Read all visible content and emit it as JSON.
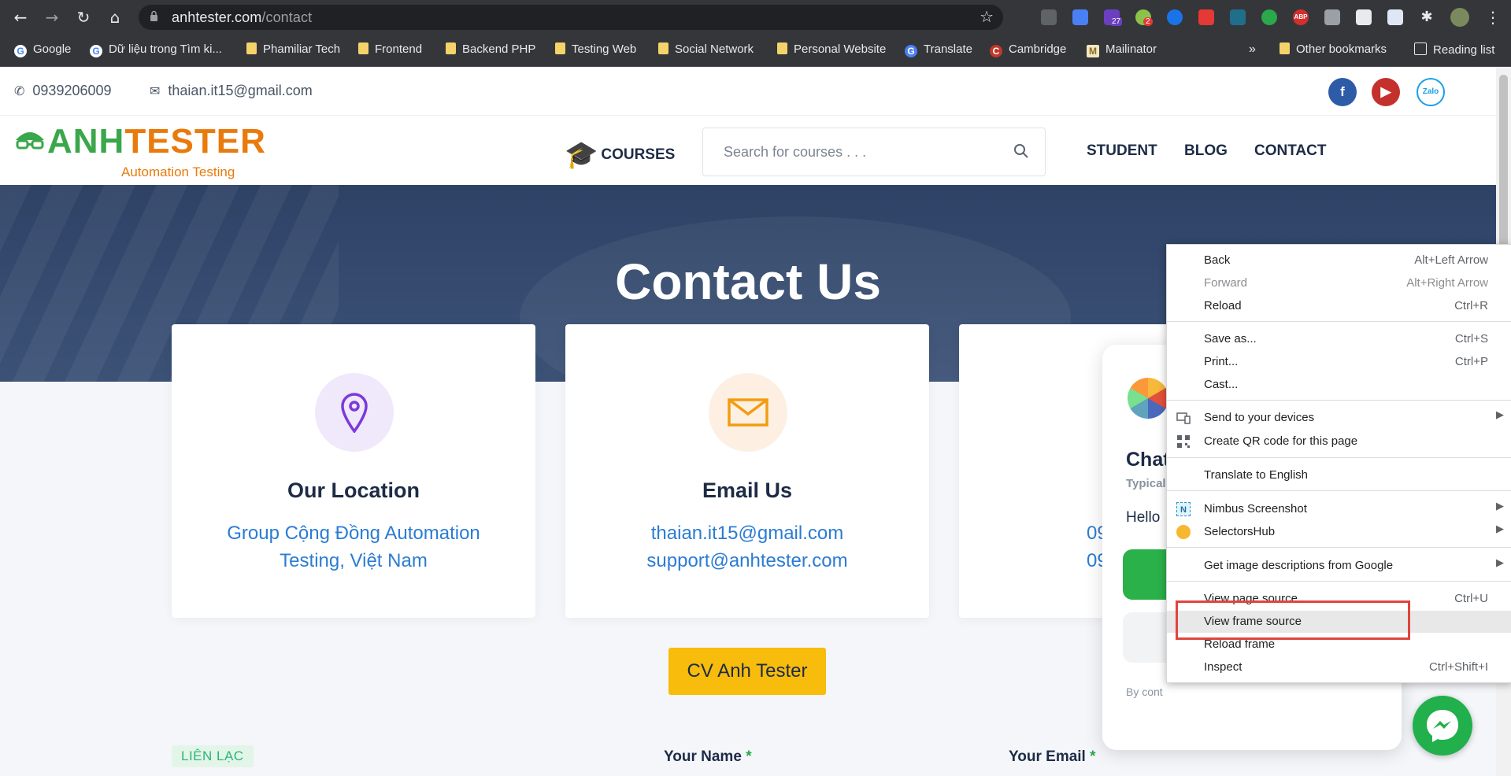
{
  "browser": {
    "url_host": "anhtester.com",
    "url_path": "/contact",
    "ext_badges": {
      "purple": "27",
      "red": "2"
    },
    "ext_abp": "ABP",
    "bookmarks": [
      {
        "label": "Google",
        "type": "google"
      },
      {
        "label": "Dữ liệu trong Tìm ki...",
        "type": "google"
      },
      {
        "label": "Phamiliar Tech",
        "type": "folder"
      },
      {
        "label": "Frontend",
        "type": "folder"
      },
      {
        "label": "Backend PHP",
        "type": "folder"
      },
      {
        "label": "Testing Web",
        "type": "folder"
      },
      {
        "label": "Social Network",
        "type": "folder"
      },
      {
        "label": "Personal Website",
        "type": "folder"
      },
      {
        "label": "Translate",
        "type": "translate"
      },
      {
        "label": "Cambridge",
        "type": "cambridge"
      },
      {
        "label": "Mailinator",
        "type": "mail"
      }
    ],
    "more_bookmarks": "»",
    "other_bookmarks": "Other bookmarks",
    "reading_list": "Reading list"
  },
  "site": {
    "phone": "0939206009",
    "email": "thaian.it15@gmail.com",
    "social": {
      "zalo": "Zalo"
    },
    "logo_text": "ANHTESTER",
    "logo_sub": "Automation Testing",
    "nav": {
      "courses": "COURSES",
      "search_placeholder": "Search for courses . . .",
      "student": "STUDENT",
      "blog": "BLOG",
      "contact": "CONTACT"
    },
    "hero_title": "Contact Us",
    "cards": [
      {
        "title": "Our Location",
        "lines": [
          "Group Cộng Đồng Automation",
          "Testing, Việt Nam"
        ],
        "icon": "location-pin-icon"
      },
      {
        "title": "Email Us",
        "lines": [
          "thaian.it15@gmail.com",
          "support@anhtester.com"
        ],
        "icon": "envelope-icon"
      },
      {
        "title": "",
        "lines": [
          "09",
          "09"
        ],
        "icon": "phone-icon"
      }
    ],
    "cv_button": "CV Anh Tester",
    "section_tag": "LIÊN LẠC",
    "form": {
      "name_label": "Your Name",
      "email_label": "Your Email",
      "required_mark": "*"
    }
  },
  "chat": {
    "title": "Chat",
    "typical": "Typical",
    "hello": "Hello",
    "footer": "By cont"
  },
  "context_menu": {
    "items": [
      {
        "label": "Back",
        "shortcut": "Alt+Left Arrow"
      },
      {
        "label": "Forward",
        "shortcut": "Alt+Right Arrow",
        "disabled": true
      },
      {
        "label": "Reload",
        "shortcut": "Ctrl+R"
      },
      {
        "label": "Save as...",
        "shortcut": "Ctrl+S"
      },
      {
        "label": "Print...",
        "shortcut": "Ctrl+P"
      },
      {
        "label": "Cast...",
        "shortcut": ""
      },
      {
        "label": "Send to your devices",
        "submenu": true,
        "icon": "devices-icon"
      },
      {
        "label": "Create QR code for this page",
        "icon": "qr-code-icon"
      },
      {
        "label": "Translate to English"
      },
      {
        "label": "Nimbus Screenshot",
        "submenu": true,
        "icon": "nimbus-icon"
      },
      {
        "label": "SelectorsHub",
        "submenu": true,
        "icon": "selectorshub-icon"
      },
      {
        "label": "Get image descriptions from Google",
        "submenu": true
      },
      {
        "label": "View page source",
        "shortcut": "Ctrl+U"
      },
      {
        "label": "View frame source",
        "highlighted": true
      },
      {
        "label": "Reload frame"
      },
      {
        "label": "Inspect",
        "shortcut": "Ctrl+Shift+I"
      }
    ]
  },
  "colors": {
    "accent_blue": "#2b7cd3",
    "logo_green": "#3aa74a",
    "logo_orange": "#e97a0c",
    "hero_bg": "#2e4266",
    "cv_yellow": "#f7bc0c",
    "highlight_red": "#e0443e",
    "messenger_green": "#21b04b"
  }
}
